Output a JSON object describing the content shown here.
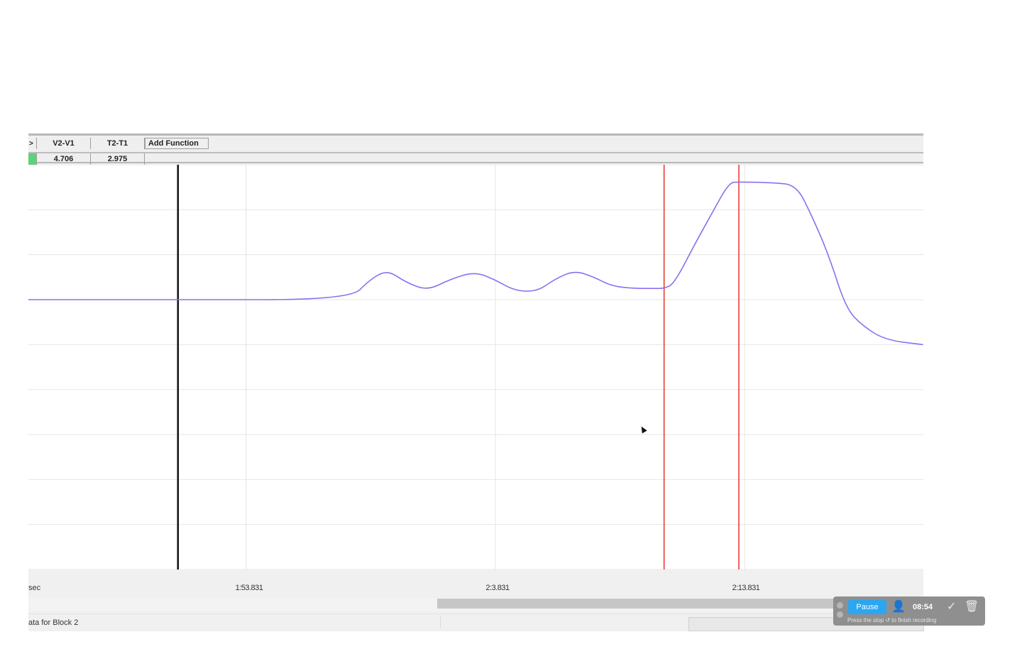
{
  "measurements": {
    "arrow_glyph": ">",
    "headers": [
      "V2-V1",
      "T2-T1"
    ],
    "add_function_label": "Add Function",
    "values": [
      "4.706",
      "2.975"
    ]
  },
  "axis": {
    "unit": "sec",
    "ticks": [
      {
        "label": "1:53.831",
        "time": 113.831
      },
      {
        "label": "2:3.831",
        "time": 123.831
      },
      {
        "label": "2:13.831",
        "time": 133.831
      }
    ]
  },
  "status": {
    "label": "ata for Block 2"
  },
  "recorder": {
    "pause_label": "Pause",
    "time": "08:54",
    "hint": "Press the stop ↺ to finish recording"
  },
  "colors": {
    "trace": "#8c6ff0",
    "cursor_line": "#e8302c",
    "marker_line": "#111111",
    "gridline": "#e6e6e6",
    "accent": "#2aa7f0"
  },
  "chart_data": {
    "type": "line",
    "title": "",
    "xlabel": "sec",
    "ylabel": "",
    "xlim": [
      105.1,
      141.0
    ],
    "ylim": [
      -6,
      3
    ],
    "grid": true,
    "x_ticks": [
      113.831,
      123.831,
      133.831
    ],
    "markers": [
      {
        "kind": "marker",
        "x": 111.1
      }
    ],
    "cursors": [
      {
        "kind": "cursor",
        "x": 130.6
      },
      {
        "kind": "cursor",
        "x": 133.6
      }
    ],
    "series": [
      {
        "x": [
          105.1,
          111.1,
          118.0,
          118.8,
          119.5,
          120.2,
          121.1,
          122.0,
          123.0,
          123.8,
          124.6,
          125.5,
          126.2,
          127.0,
          127.8,
          128.5,
          129.4,
          130.2,
          130.6,
          131.0,
          131.8,
          132.5,
          133.2,
          133.6,
          135.0,
          135.9,
          136.5,
          137.2,
          137.9,
          138.6,
          139.5,
          141.0
        ],
        "y": [
          0.0,
          0.0,
          0.0,
          0.45,
          0.66,
          0.4,
          0.2,
          0.45,
          0.62,
          0.45,
          0.2,
          0.18,
          0.45,
          0.65,
          0.5,
          0.3,
          0.25,
          0.25,
          0.25,
          0.35,
          1.2,
          1.9,
          2.6,
          2.62,
          2.6,
          2.55,
          1.9,
          1.0,
          -0.2,
          -0.6,
          -0.9,
          -1.0
        ]
      }
    ]
  }
}
